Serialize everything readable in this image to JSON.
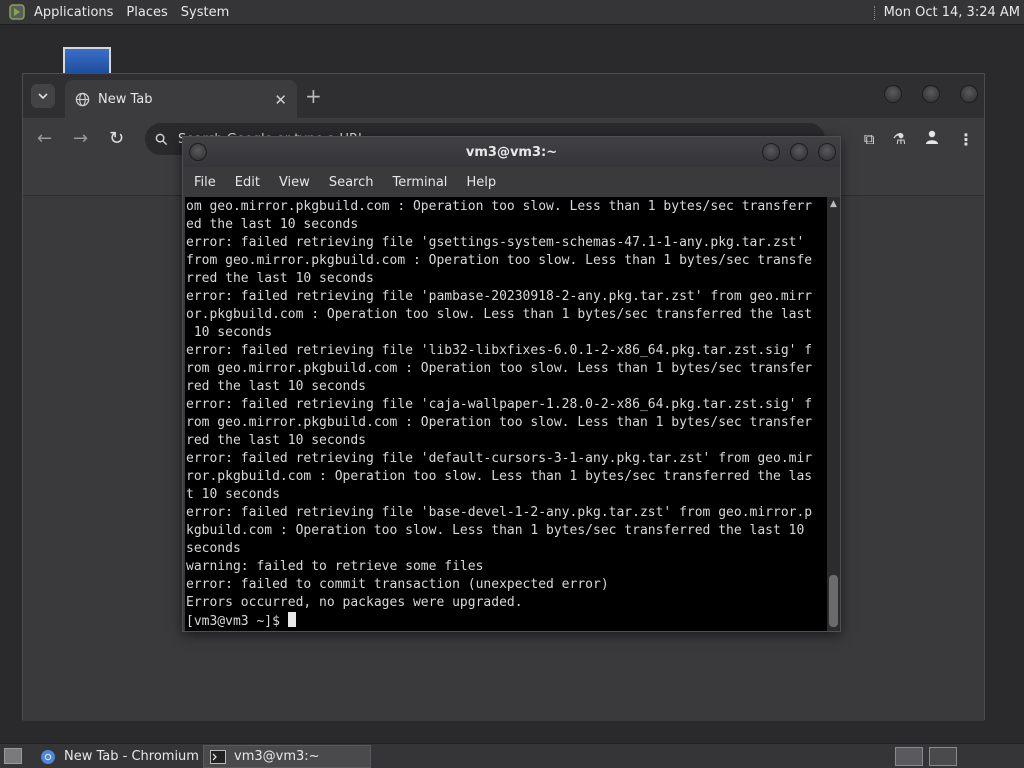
{
  "top_panel": {
    "menus": [
      "Applications",
      "Places",
      "System"
    ],
    "clock": "Mon Oct 14,  3:24 AM"
  },
  "chromium": {
    "tab_title": "New Tab",
    "omnibox_text": "Search Google or type a URL"
  },
  "terminal": {
    "title": "vm3@vm3:~",
    "menu": [
      "File",
      "Edit",
      "View",
      "Search",
      "Terminal",
      "Help"
    ],
    "lines": [
      "om geo.mirror.pkgbuild.com : Operation too slow. Less than 1 bytes/sec transferr",
      "ed the last 10 seconds",
      "error: failed retrieving file 'gsettings-system-schemas-47.1-1-any.pkg.tar.zst'",
      "from geo.mirror.pkgbuild.com : Operation too slow. Less than 1 bytes/sec transfe",
      "rred the last 10 seconds",
      "error: failed retrieving file 'pambase-20230918-2-any.pkg.tar.zst' from geo.mirr",
      "or.pkgbuild.com : Operation too slow. Less than 1 bytes/sec transferred the last",
      " 10 seconds",
      "error: failed retrieving file 'lib32-libxfixes-6.0.1-2-x86_64.pkg.tar.zst.sig' f",
      "rom geo.mirror.pkgbuild.com : Operation too slow. Less than 1 bytes/sec transfer",
      "red the last 10 seconds",
      "error: failed retrieving file 'caja-wallpaper-1.28.0-2-x86_64.pkg.tar.zst.sig' f",
      "rom geo.mirror.pkgbuild.com : Operation too slow. Less than 1 bytes/sec transfer",
      "red the last 10 seconds",
      "error: failed retrieving file 'default-cursors-3-1-any.pkg.tar.zst' from geo.mir",
      "ror.pkgbuild.com : Operation too slow. Less than 1 bytes/sec transferred the las",
      "t 10 seconds",
      "error: failed retrieving file 'base-devel-1-2-any.pkg.tar.zst' from geo.mirror.p",
      "kgbuild.com : Operation too slow. Less than 1 bytes/sec transferred the last 10",
      "seconds",
      "warning: failed to retrieve some files",
      "error: failed to commit transaction (unexpected error)",
      "Errors occurred, no packages were upgraded."
    ],
    "prompt": "[vm3@vm3 ~]$ "
  },
  "taskbar": {
    "tasks": [
      "New Tab - Chromium",
      "vm3@vm3:~"
    ]
  }
}
